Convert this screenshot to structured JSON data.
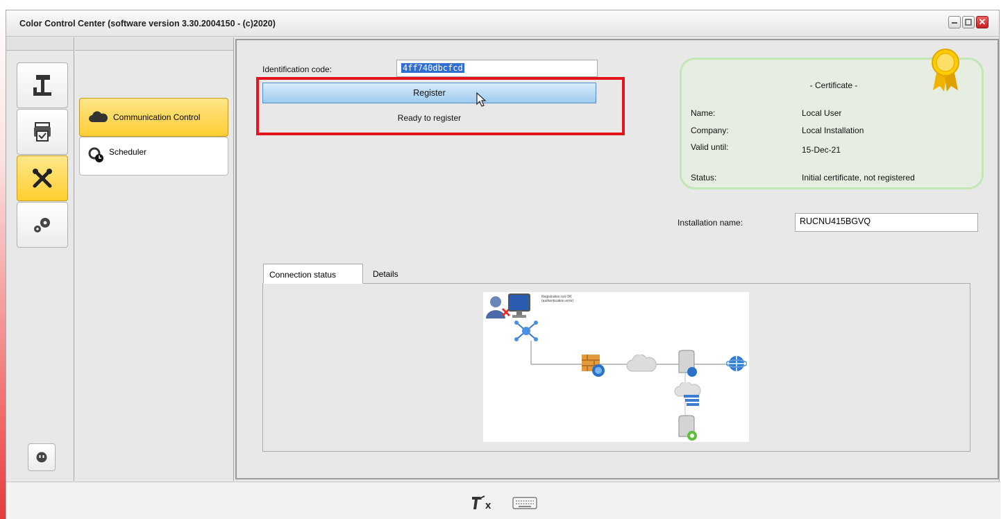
{
  "window": {
    "title": "Color Control Center (software version 3.30.2004150 - (c)2020)"
  },
  "sidebar": {
    "icons": [
      {
        "name": "press-icon",
        "active": false
      },
      {
        "name": "print-queue-icon",
        "active": false
      },
      {
        "name": "tools-icon",
        "active": true
      },
      {
        "name": "gears-icon",
        "active": false
      }
    ],
    "bottom_icon": "plug-icon"
  },
  "nav": {
    "items": [
      {
        "label": "Communication Control",
        "icon": "cloud-icon",
        "active": true
      },
      {
        "label": "Scheduler",
        "icon": "scheduler-icon",
        "active": false
      }
    ]
  },
  "registration": {
    "id_label": "Identification code:",
    "id_value": "4ff740dbcfcd",
    "register_label": "Register",
    "status_text": "Ready to register"
  },
  "certificate": {
    "title": "- Certificate -",
    "fields": [
      {
        "label": "Name:",
        "value": "Local User"
      },
      {
        "label": "Company:",
        "value": "Local Installation"
      },
      {
        "label": "Valid until:",
        "value": "15-Dec-21"
      },
      {
        "label": "Status:",
        "value": "Initial certificate, not registered"
      }
    ]
  },
  "installation": {
    "label": "Installation name:",
    "value": "RUCNU415BGVQ"
  },
  "tabs": [
    {
      "label": "Connection status",
      "active": true
    },
    {
      "label": "Details",
      "active": false
    }
  ],
  "diagram": {
    "note_line1": "Registration not OK",
    "note_line2": "(authentication error)"
  },
  "statusbar": {
    "icons": [
      "spray-gun-x-icon",
      "keyboard-icon"
    ],
    "spray_suffix": "x"
  },
  "colors": {
    "active_yellow": "#ffd23f",
    "highlight_red": "#e5131b",
    "selection_blue": "#2f6ed3",
    "cert_green": "#c3e6b5"
  }
}
